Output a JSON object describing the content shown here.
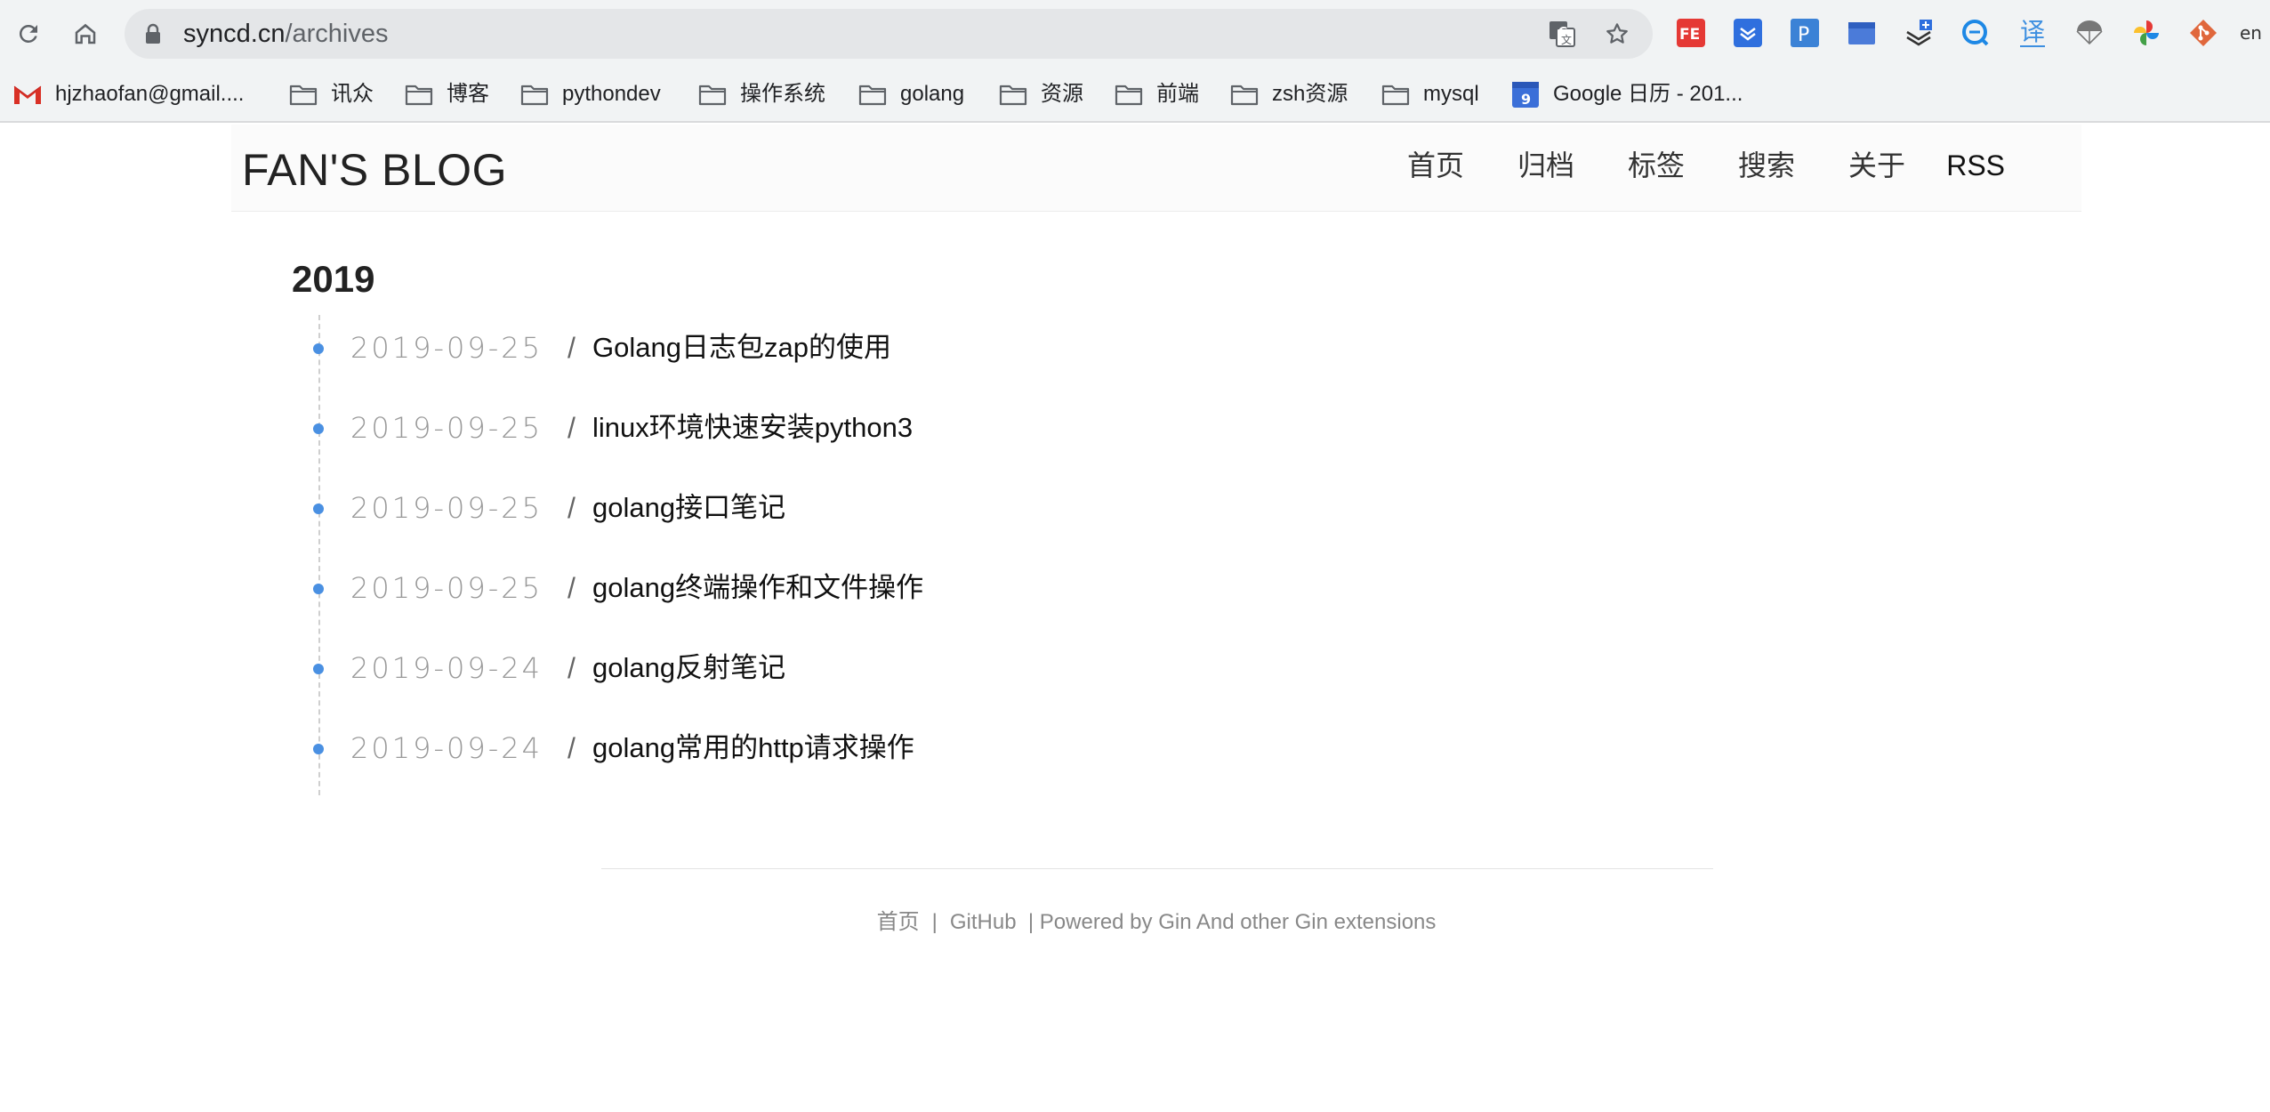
{
  "browser": {
    "url_host": "syncd.cn",
    "url_path": "/archives",
    "bookmarks": [
      {
        "label": "hjzhaofan@gmail....",
        "icon": "gmail-icon"
      },
      {
        "label": "讯众",
        "icon": "folder-icon"
      },
      {
        "label": "博客",
        "icon": "folder-icon"
      },
      {
        "label": "pythondev",
        "icon": "folder-icon"
      },
      {
        "label": "操作系统",
        "icon": "folder-icon"
      },
      {
        "label": "golang",
        "icon": "folder-icon"
      },
      {
        "label": "资源",
        "icon": "folder-icon"
      },
      {
        "label": "前端",
        "icon": "folder-icon"
      },
      {
        "label": "zsh资源",
        "icon": "folder-icon"
      },
      {
        "label": "mysql",
        "icon": "folder-icon"
      },
      {
        "label": "Google 日历 - 201...",
        "icon": "google-calendar-icon",
        "badge": "9"
      }
    ],
    "extensions": {
      "fe_badge": "FE",
      "p_badge": "P",
      "translate_label": "译",
      "en_label": "en"
    }
  },
  "site": {
    "title": "FAN'S BLOG",
    "nav": [
      "首页",
      "归档",
      "标签",
      "搜索",
      "关于",
      "RSS"
    ]
  },
  "archive": {
    "year": "2019",
    "posts": [
      {
        "date": "2019-09-25",
        "sep": "/",
        "title": "Golang日志包zap的使用"
      },
      {
        "date": "2019-09-25",
        "sep": "/",
        "title": "linux环境快速安装python3"
      },
      {
        "date": "2019-09-25",
        "sep": "/",
        "title": "golang接口笔记"
      },
      {
        "date": "2019-09-25",
        "sep": "/",
        "title": "golang终端操作和文件操作"
      },
      {
        "date": "2019-09-24",
        "sep": "/",
        "title": "golang反射笔记"
      },
      {
        "date": "2019-09-24",
        "sep": "/",
        "title": "golang常用的http请求操作"
      }
    ]
  },
  "footer": {
    "home": "首页",
    "pipe": "|",
    "github": "GitHub",
    "powered": "| Powered by Gin And other Gin extensions"
  },
  "colors": {
    "accent_dot": "#4a90e2",
    "date_gray": "#999999",
    "toolbar_bg": "#f1f3f4"
  }
}
